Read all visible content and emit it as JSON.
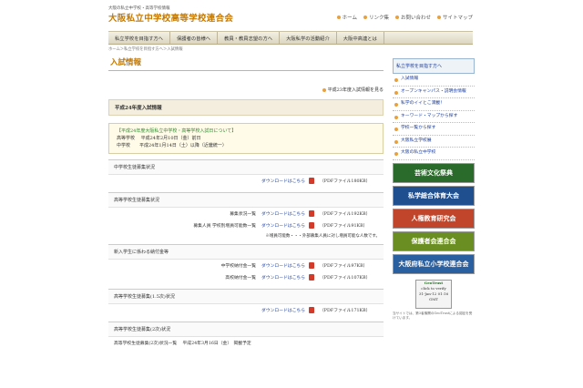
{
  "header": {
    "tagline": "大阪の私立中学校・高等学校情報",
    "site_title": "大阪私立中学校高等学校連合会",
    "links": [
      "ホーム",
      "リンク集",
      "お問い合わせ",
      "サイトマップ"
    ]
  },
  "nav": [
    "私立学校を目指す方へ",
    "保護者の皆様へ",
    "教員・教員志望の方へ",
    "大阪私学の活動紹介",
    "大阪中高連とは"
  ],
  "breadcrumb": "ホーム＞私立学校を目指す方へ＞入試情報",
  "main": {
    "heading": "入試情報",
    "prev_link": "平成23年度入試情報を見る",
    "section_title": "平成24年度入試情報",
    "notice": {
      "title": "【平成24年度大阪私立中学校・高等学校入試日について】",
      "line1": "高等学校　 平成24年2月10日（金）前日",
      "line2": "中学校　　平成24年1月14日（土）以降（近畿統一）"
    },
    "boxes": [
      {
        "title": "中学校生徒募集状況",
        "rows": [
          {
            "label": "",
            "link": "ダウンロードはこちら",
            "pdf": "（PDFファイル180KB）"
          }
        ]
      },
      {
        "title": "高等学校生徒募集状況",
        "rows": [
          {
            "label": "募集状況一覧",
            "link": "ダウンロードはこちら",
            "pdf": "（PDFファイル192KB）"
          },
          {
            "label": "募集人員 学校別増員可能数一覧",
            "link": "ダウンロードはこちら",
            "pdf": "（PDFファイル91KB）"
          }
        ],
        "note": "※増員可能数・・・外部募集人員に対し増員可能な人数です。"
      },
      {
        "title": "新入学生に係わる納付金等",
        "rows": [
          {
            "label": "中学校納付金一覧",
            "link": "ダウンロードはこちら",
            "pdf": "（PDFファイル97KB）"
          },
          {
            "label": "高校納付金一覧",
            "link": "ダウンロードはこちら",
            "pdf": "（PDFファイル107KB）"
          }
        ]
      },
      {
        "title": "高等学校生徒募集(1.5次)状況",
        "rows": [
          {
            "label": "",
            "link": "ダウンロードはこちら",
            "pdf": "（PDFファイル171KB）"
          }
        ]
      },
      {
        "title": "高等学校生徒募集(2次)状況",
        "text": "高等学校生徒募集(2次)状況一覧　 平成24年3月16日（金）　掲載予定"
      }
    ]
  },
  "sidebar": {
    "heading": "私立学校を目指す方へ",
    "items": [
      "入試情報",
      "オープンキャンパス・説明会情報",
      "私学のイイとこ満載！",
      "キーワード・マップから探す",
      "学校一覧から探す",
      "大阪私立学校展",
      "大阪の私立中学校"
    ],
    "banners": [
      {
        "text": "芸術文化祭典",
        "color": "#2a6a2a"
      },
      {
        "text": "私学総合体育大会",
        "color": "#1f4f8f"
      },
      {
        "text": "人権教育研究会",
        "color": "#c0452a"
      },
      {
        "text": "保護者会連合会",
        "color": "#6b8e23"
      },
      {
        "text": "大阪府私立小学校連合会",
        "color": "#2a5fa0"
      }
    ],
    "trust": {
      "title": "GeoTrust",
      "sub": "click to verify",
      "date": "31-Jan-12 01:16 GMT"
    },
    "foot": "当サイトでは、第3者機関のGeoTrustによる認証を受けています。"
  }
}
